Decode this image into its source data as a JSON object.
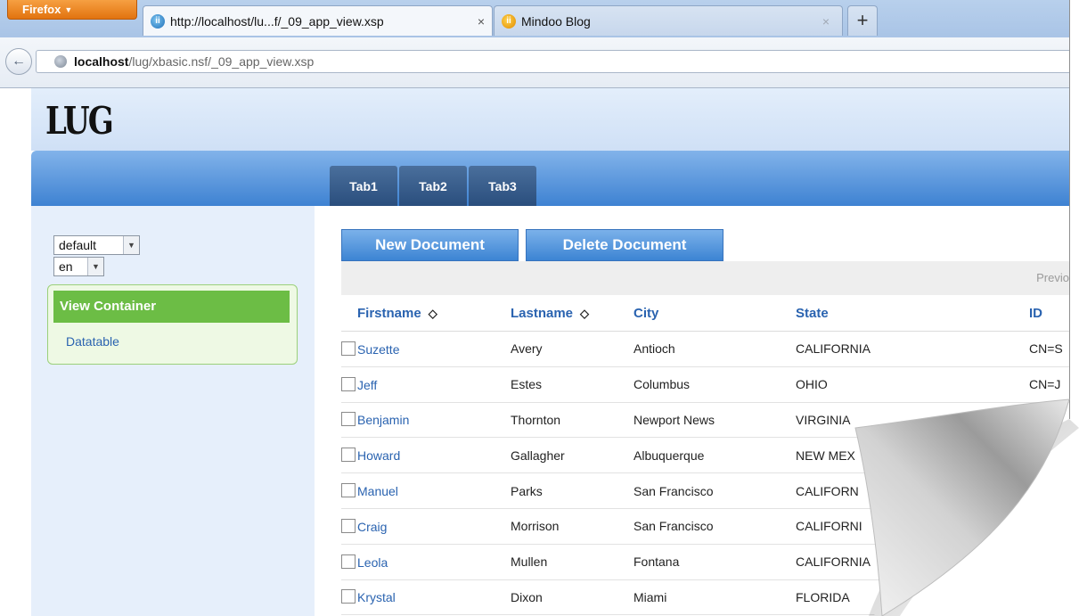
{
  "browser": {
    "menu_label": "Firefox",
    "tabs": [
      {
        "title": "http://localhost/lu...f/_09_app_view.xsp",
        "close": "×",
        "active": true
      },
      {
        "title": "Mindoo Blog",
        "close": "×",
        "active": false
      }
    ],
    "new_tab": "+",
    "back_glyph": "←",
    "url_host": "localhost",
    "url_path": "/lug/xbasic.nsf/_09_app_view.xsp"
  },
  "app": {
    "logo": "LUG",
    "tabs": [
      "Tab1",
      "Tab2",
      "Tab3"
    ]
  },
  "sidebar": {
    "theme_select": "default",
    "lang_select": "en",
    "nav": [
      {
        "label": "View Container",
        "active": true
      },
      {
        "label": "Datatable",
        "active": false
      }
    ]
  },
  "toolbar": {
    "new_label": "New Document",
    "delete_label": "Delete Document"
  },
  "pager": {
    "label": "Previo"
  },
  "table": {
    "columns": [
      "Firstname",
      "Lastname",
      "City",
      "State",
      "ID"
    ],
    "sort_glyph": "◇",
    "rows": [
      {
        "first": "Suzette",
        "last": "Avery",
        "city": "Antioch",
        "state": "CALIFORNIA",
        "id": "CN=S"
      },
      {
        "first": "Jeff",
        "last": "Estes",
        "city": "Columbus",
        "state": "OHIO",
        "id": "CN=J"
      },
      {
        "first": "Benjamin",
        "last": "Thornton",
        "city": "Newport News",
        "state": "VIRGINIA",
        "id": ""
      },
      {
        "first": "Howard",
        "last": "Gallagher",
        "city": "Albuquerque",
        "state": "NEW MEX",
        "id": ""
      },
      {
        "first": "Manuel",
        "last": "Parks",
        "city": "San Francisco",
        "state": "CALIFORN",
        "id": ""
      },
      {
        "first": "Craig",
        "last": "Morrison",
        "city": "San Francisco",
        "state": "CALIFORNI",
        "id": ""
      },
      {
        "first": "Leola",
        "last": "Mullen",
        "city": "Fontana",
        "state": "CALIFORNIA",
        "id": ""
      },
      {
        "first": "Krystal",
        "last": "Dixon",
        "city": "Miami",
        "state": "FLORIDA",
        "id": ""
      }
    ]
  },
  "colors": {
    "accent_blue": "#3e82d2",
    "nav_green": "#6cbd45",
    "link_blue": "#2a63b0",
    "firefox_orange": "#e2730f"
  }
}
